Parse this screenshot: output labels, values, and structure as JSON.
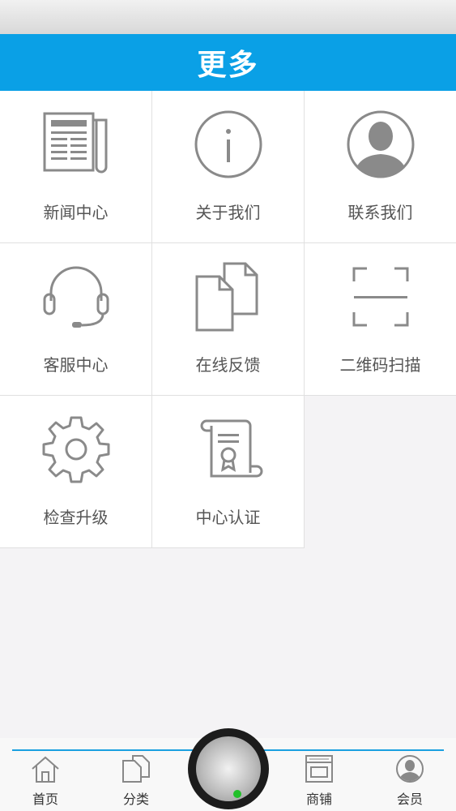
{
  "header": {
    "title": "更多"
  },
  "grid": {
    "items": [
      {
        "label": "新闻中心",
        "icon": "newspaper-icon"
      },
      {
        "label": "关于我们",
        "icon": "info-icon"
      },
      {
        "label": "联系我们",
        "icon": "person-icon"
      },
      {
        "label": "客服中心",
        "icon": "headset-icon"
      },
      {
        "label": "在线反馈",
        "icon": "documents-icon"
      },
      {
        "label": "二维码扫描",
        "icon": "scan-icon"
      },
      {
        "label": "检查升级",
        "icon": "gear-icon"
      },
      {
        "label": "中心认证",
        "icon": "certificate-icon"
      }
    ]
  },
  "tabbar": {
    "tabs": [
      {
        "label": "首页",
        "icon": "home-icon"
      },
      {
        "label": "分类",
        "icon": "category-icon"
      },
      {
        "label": "商铺",
        "icon": "shop-icon"
      },
      {
        "label": "会员",
        "icon": "member-icon"
      }
    ],
    "accent": "#1aa0e0"
  },
  "colors": {
    "header": "#0aa0e6",
    "icon_stroke": "#8a8a8a",
    "center_dot": "#22c02a"
  }
}
